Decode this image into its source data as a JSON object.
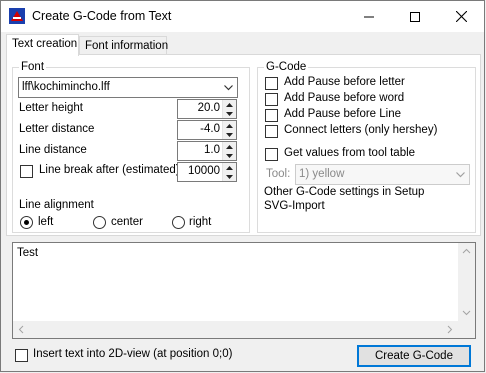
{
  "window": {
    "title": "Create G-Code from Text"
  },
  "tabs": [
    {
      "label": "Text creation",
      "active": true
    },
    {
      "label": "Font information",
      "active": false
    }
  ],
  "font": {
    "legend": "Font",
    "selected": "lff\\kochimincho.lff",
    "letter_height_label": "Letter height",
    "letter_height": "20.0",
    "letter_distance_label": "Letter distance",
    "letter_distance": "-4.0",
    "line_distance_label": "Line distance",
    "line_distance": "1.0",
    "line_break_label": "Line break after (estimated)",
    "line_break_checked": false,
    "line_break": "10000",
    "alignment_label": "Line alignment",
    "alignment_options": [
      "left",
      "center",
      "right"
    ],
    "alignment_selected": "left"
  },
  "gcode": {
    "legend": "G-Code",
    "pause_letter": "Add Pause before letter",
    "pause_word": "Add Pause before word",
    "pause_line": "Add Pause before Line",
    "connect_letters": "Connect letters (only hershey)",
    "tool_table": "Get values from tool table",
    "tool_label": "Tool:",
    "tool_value": "1) yellow",
    "other_settings": "Other G-Code settings in Setup",
    "svg_import": "SVG-Import"
  },
  "text_input": {
    "value": "Test"
  },
  "bottom": {
    "insert_label": "Insert text into 2D-view (at position 0;0)",
    "insert_checked": false,
    "create_button": "Create G-Code"
  },
  "colors": {
    "focus_blue": "#0078d7",
    "panel_bg": "#f0f0f0",
    "icon_red": "#d40000",
    "icon_blue": "#1a3fae"
  }
}
